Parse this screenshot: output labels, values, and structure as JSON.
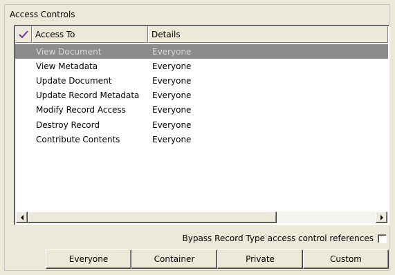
{
  "panel": {
    "title": "Access Controls"
  },
  "table": {
    "columns": [
      "Access To",
      "Details"
    ],
    "rows": [
      {
        "access": "View Document",
        "details": "Everyone",
        "selected": true
      },
      {
        "access": "View Metadata",
        "details": "Everyone"
      },
      {
        "access": "Update Document",
        "details": "Everyone"
      },
      {
        "access": "Update Record Metadata",
        "details": "Everyone"
      },
      {
        "access": "Modify Record Access",
        "details": "Everyone"
      },
      {
        "access": "Destroy Record",
        "details": "Everyone"
      },
      {
        "access": "Contribute Contents",
        "details": "Everyone"
      }
    ]
  },
  "bypass": {
    "label": "Bypass Record Type access control references",
    "checked": false
  },
  "buttons": {
    "everyone": "Everyone",
    "container": "Container",
    "private": "Private",
    "custom": "Custom"
  },
  "colors": {
    "checkmark": "#7a2fb0",
    "selected_row": "#8c8c8c"
  }
}
